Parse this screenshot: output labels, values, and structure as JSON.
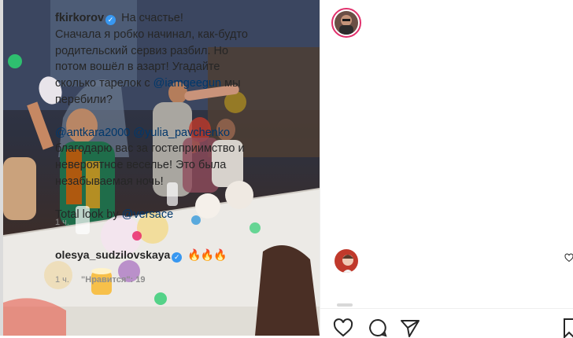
{
  "post": {
    "username": "fkirkorov",
    "caption_first_line": "На счастье!",
    "caption_lines": [
      "Сначала я робко начинал, как-будто",
      "родительский сервиз разбил. Но",
      "потом вошёл в азарт! Угадайте",
      "сколько тарелок с "
    ],
    "mention_iamgeegun": "@iamgeegun",
    "caption_after_mention": " мы",
    "caption_last": "перебили?",
    "mention_antkara": "@antkara2000",
    "mention_yulia": "@yulia_pavchenko",
    "thanks_lines": [
      "благодарю вас за гостеприимство и",
      "невероятное веселье! Это была",
      "незабываемая ночь!"
    ],
    "total_look": "Total look by ",
    "mention_versace": "@versace",
    "time": "1 ч."
  },
  "comment": {
    "username": "olesya_sudzilovskaya",
    "text": "🔥🔥🔥",
    "time": "1 ч.",
    "likes_label": "\"Нравится\": 19"
  },
  "colors": {
    "accent_link": "#00376b",
    "verified": "#3897f0",
    "story_ring": "#e1306c",
    "muted": "#8e8e8e"
  },
  "icons": [
    "verified-badge-icon",
    "heart-icon",
    "comment-icon",
    "share-icon",
    "bookmark-icon"
  ]
}
